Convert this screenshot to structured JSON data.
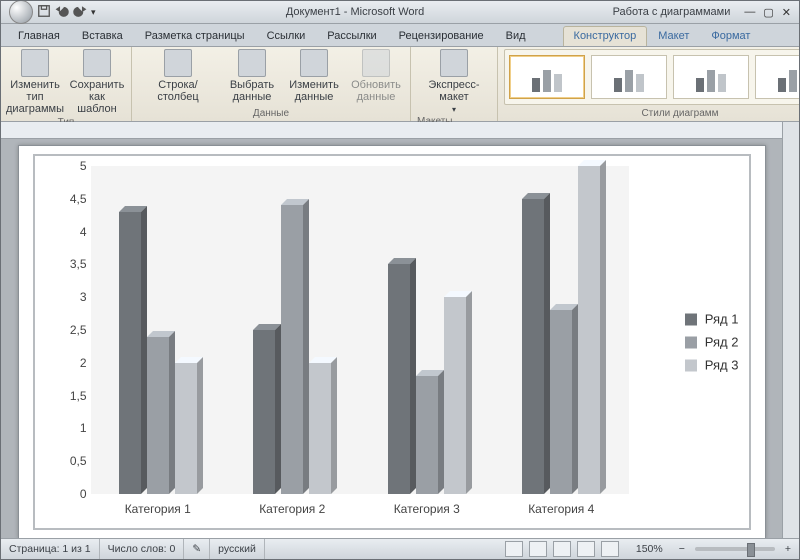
{
  "title_doc": "Документ1 - Microsoft Word",
  "context_title": "Работа с диаграммами",
  "tabs": [
    "Главная",
    "Вставка",
    "Разметка страницы",
    "Ссылки",
    "Рассылки",
    "Рецензирование",
    "Вид"
  ],
  "context_tabs": [
    "Конструктор",
    "Макет",
    "Формат"
  ],
  "active_context_tab": "Конструктор",
  "ribbon": {
    "type_group": {
      "label": "Тип",
      "btn_change": "Изменить тип\nдиаграммы",
      "btn_save": "Сохранить\nкак шаблон"
    },
    "data_group": {
      "label": "Данные",
      "btn_switch": "Строка/столбец",
      "btn_select": "Выбрать\nданные",
      "btn_edit": "Изменить\nданные",
      "btn_refresh": "Обновить\nданные"
    },
    "layout_group": {
      "label": "Макеты диаграмм",
      "btn_express": "Экспресс-макет"
    },
    "styles_group": {
      "label": "Стили диаграмм"
    }
  },
  "status": {
    "page": "Страница: 1 из 1",
    "words": "Число слов: 0",
    "lang": "русский",
    "zoom": "150%"
  },
  "chart_data": {
    "type": "bar",
    "title": "",
    "xlabel": "",
    "ylabel": "",
    "ylim": [
      0,
      5
    ],
    "yticks": [
      0,
      0.5,
      1,
      1.5,
      2,
      2.5,
      3,
      3.5,
      4,
      4.5,
      5
    ],
    "ytick_labels": [
      "0",
      "0,5",
      "1",
      "1,5",
      "2",
      "2,5",
      "3",
      "3,5",
      "4",
      "4,5",
      "5"
    ],
    "categories": [
      "Категория 1",
      "Категория 2",
      "Категория 3",
      "Категория 4"
    ],
    "series": [
      {
        "name": "Ряд 1",
        "values": [
          4.3,
          2.5,
          3.5,
          4.5
        ]
      },
      {
        "name": "Ряд 2",
        "values": [
          2.4,
          4.4,
          1.8,
          2.8
        ]
      },
      {
        "name": "Ряд 3",
        "values": [
          2.0,
          2.0,
          3.0,
          5.0
        ]
      }
    ]
  }
}
